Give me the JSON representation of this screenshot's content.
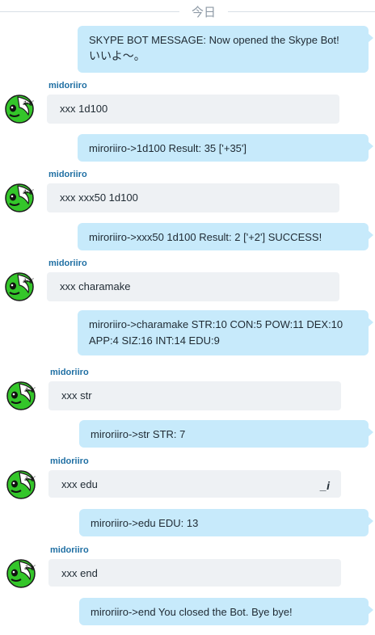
{
  "date_separator": "今日",
  "messages": [
    {
      "type": "out",
      "lines": [
        "SKYPE BOT MESSAGE: Now opened the Skype Bot!",
        "いいよ〜。"
      ]
    },
    {
      "type": "in",
      "sender": "midoriiro",
      "text": "xxx 1d100"
    },
    {
      "type": "out",
      "lines": [
        "miroriiro->1d100 Result: 35 ['+35']"
      ]
    },
    {
      "type": "in",
      "sender": "midoriiro",
      "text": "xxx xxx50 1d100"
    },
    {
      "type": "out",
      "lines": [
        "miroriiro->xxx50 1d100 Result: 2 ['+2'] SUCCESS!"
      ]
    },
    {
      "type": "in",
      "sender": "midoriiro",
      "text": "xxx charamake"
    },
    {
      "type": "out",
      "lines": [
        "miroriiro->charamake STR:10 CON:5 POW:11 DEX:10",
        "APP:4 SIZ:16 INT:14 EDU:9"
      ]
    },
    {
      "type": "in",
      "sender": "midoriiro",
      "text": "xxx str"
    },
    {
      "type": "out",
      "lines": [
        "miroriiro->str STR: 7"
      ]
    },
    {
      "type": "in",
      "sender": "midoriiro",
      "text": "xxx edu",
      "edit_mark": "_i"
    },
    {
      "type": "out",
      "lines": [
        "miroriiro->edu EDU: 13"
      ]
    },
    {
      "type": "in",
      "sender": "midoriiro",
      "text": "xxx end"
    },
    {
      "type": "out",
      "lines": [
        "miroriiro->end You closed the Bot. Bye bye!"
      ]
    }
  ],
  "colors": {
    "outgoing_bubble": "#c7eafb",
    "incoming_bubble": "#eef1f4",
    "sender_name": "#1f6fa3",
    "avatar_green": "#34c62a"
  }
}
